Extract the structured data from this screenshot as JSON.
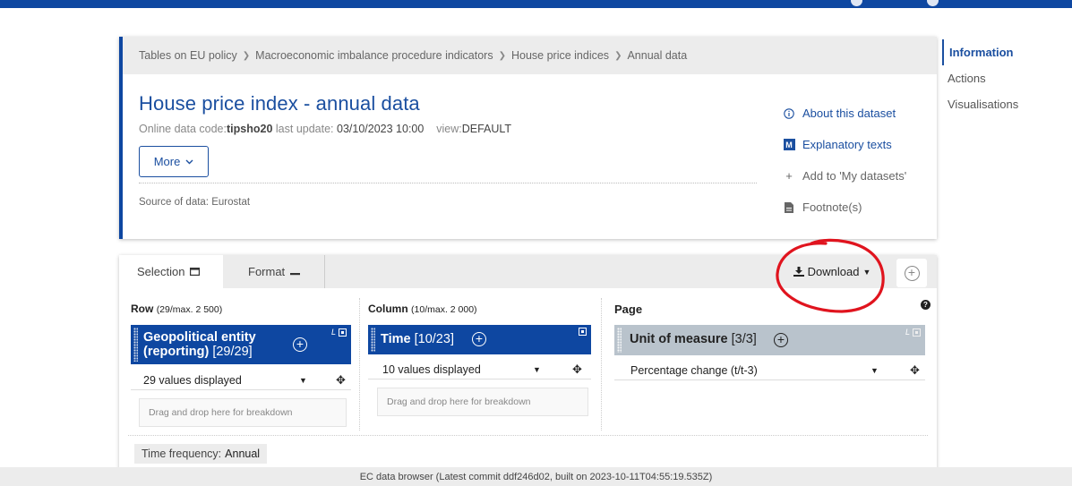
{
  "breadcrumb": [
    "Tables on EU policy",
    "Macroeconomic imbalance procedure indicators",
    "House price indices",
    "Annual data"
  ],
  "dataset": {
    "title": "House price index - annual data",
    "code_label": "Online data code:",
    "code": "tipsho20",
    "update_label": "last update:",
    "update": "03/10/2023 10:00",
    "view_label": "view:",
    "view": "DEFAULT",
    "more_label": "More",
    "source_label": "Source of data:",
    "source": "Eurostat"
  },
  "side_links": {
    "about": "About this dataset",
    "explanatory": "Explanatory texts",
    "add": "Add to 'My datasets'",
    "footnote": "Footnote(s)"
  },
  "right_nav": [
    "Information",
    "Actions",
    "Visualisations"
  ],
  "tabs": {
    "selection": "Selection",
    "format": "Format"
  },
  "download_label": "Download",
  "columns": {
    "row_title": "Row",
    "row_limit": "(29/max. 2 500)",
    "column_title": "Column",
    "column_limit": "(10/max. 2 000)",
    "page_title": "Page"
  },
  "dimensions": {
    "geo_line1": "Geopolitical entity",
    "geo_line2": "(reporting)",
    "geo_count": "[29/29]",
    "geo_values": "29 values displayed",
    "time_name": "Time",
    "time_count": "[10/23]",
    "time_values": "10 values displayed",
    "unit_name": "Unit of measure",
    "unit_count": "[3/3]",
    "unit_value": "Percentage change (t/t-3)",
    "corner_letter": "L"
  },
  "drop_hint": "Drag and drop here for breakdown",
  "time_frequency": {
    "label": "Time frequency:",
    "value": "Annual"
  },
  "footer": "EC data browser (Latest commit ddf246d02, built on 2023-10-11T04:55:19.535Z)",
  "colors": {
    "brand": "#0e47a1",
    "link": "#1b4fa0",
    "annotation": "#e0141e"
  }
}
